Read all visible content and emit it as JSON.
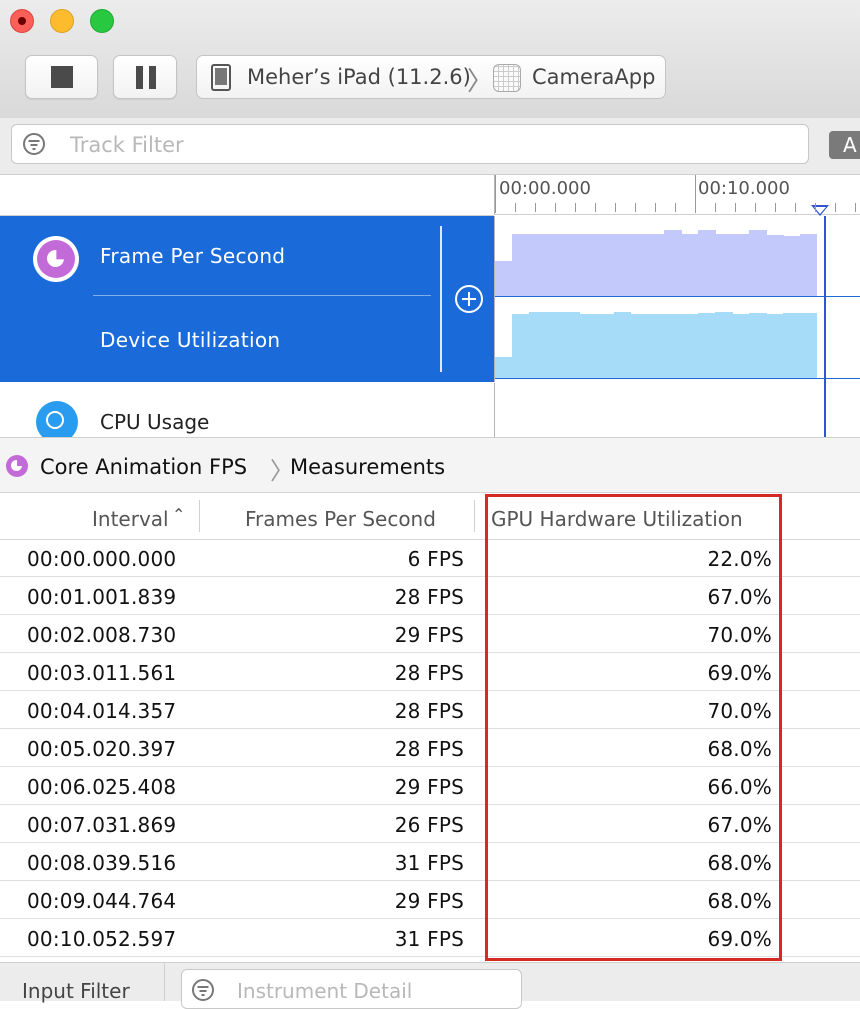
{
  "toolbar": {
    "device_name": "Meher’s iPad (11.2.6)",
    "app_name": "CameraApp",
    "strategy_label": "A"
  },
  "track_filter": {
    "placeholder": "Track Filter"
  },
  "timeline": {
    "ticks": [
      "00:00.000",
      "00:10.000"
    ],
    "tracks": [
      {
        "label": "Frame Per Second"
      },
      {
        "label": "Device Utilization"
      },
      {
        "label": "CPU Usage"
      }
    ],
    "fps_series": [
      0.54,
      0.94,
      0.95,
      0.95,
      0.95,
      0.95,
      0.94,
      0.95,
      0.95,
      0.94,
      1.0,
      0.95,
      1.0,
      0.95,
      0.94,
      1.0,
      0.93,
      0.92,
      0.94
    ],
    "util_series": [
      0.32,
      0.97,
      1.0,
      1.0,
      1.0,
      0.98,
      0.98,
      1.0,
      0.97,
      0.98,
      0.98,
      0.98,
      0.99,
      1.0,
      0.98,
      0.99,
      0.98,
      0.99,
      0.99
    ]
  },
  "detail": {
    "breadcrumb": [
      "Core Animation FPS",
      "Measurements"
    ],
    "columns": [
      "Interval",
      "Frames Per Second",
      "GPU Hardware Utilization"
    ],
    "rows": [
      {
        "interval": "00:00.000.000",
        "fps": "6 FPS",
        "gpu": "22.0%"
      },
      {
        "interval": "00:01.001.839",
        "fps": "28 FPS",
        "gpu": "67.0%"
      },
      {
        "interval": "00:02.008.730",
        "fps": "29 FPS",
        "gpu": "70.0%"
      },
      {
        "interval": "00:03.011.561",
        "fps": "28 FPS",
        "gpu": "69.0%"
      },
      {
        "interval": "00:04.014.357",
        "fps": "28 FPS",
        "gpu": "70.0%"
      },
      {
        "interval": "00:05.020.397",
        "fps": "28 FPS",
        "gpu": "68.0%"
      },
      {
        "interval": "00:06.025.408",
        "fps": "29 FPS",
        "gpu": "66.0%"
      },
      {
        "interval": "00:07.031.869",
        "fps": "26 FPS",
        "gpu": "67.0%"
      },
      {
        "interval": "00:08.039.516",
        "fps": "31 FPS",
        "gpu": "68.0%"
      },
      {
        "interval": "00:09.044.764",
        "fps": "29 FPS",
        "gpu": "68.0%"
      },
      {
        "interval": "00:10.052.597",
        "fps": "31 FPS",
        "gpu": "69.0%"
      }
    ]
  },
  "bottom": {
    "input_filter_label": "Input Filter",
    "instrument_detail_placeholder": "Instrument Detail"
  },
  "colors": {
    "selection": "#1a6bd9",
    "fps_graph": "#c3c9fa",
    "util_graph": "#a6dcf8",
    "playhead": "#2f55d4",
    "highlight_box": "#d32b22"
  }
}
